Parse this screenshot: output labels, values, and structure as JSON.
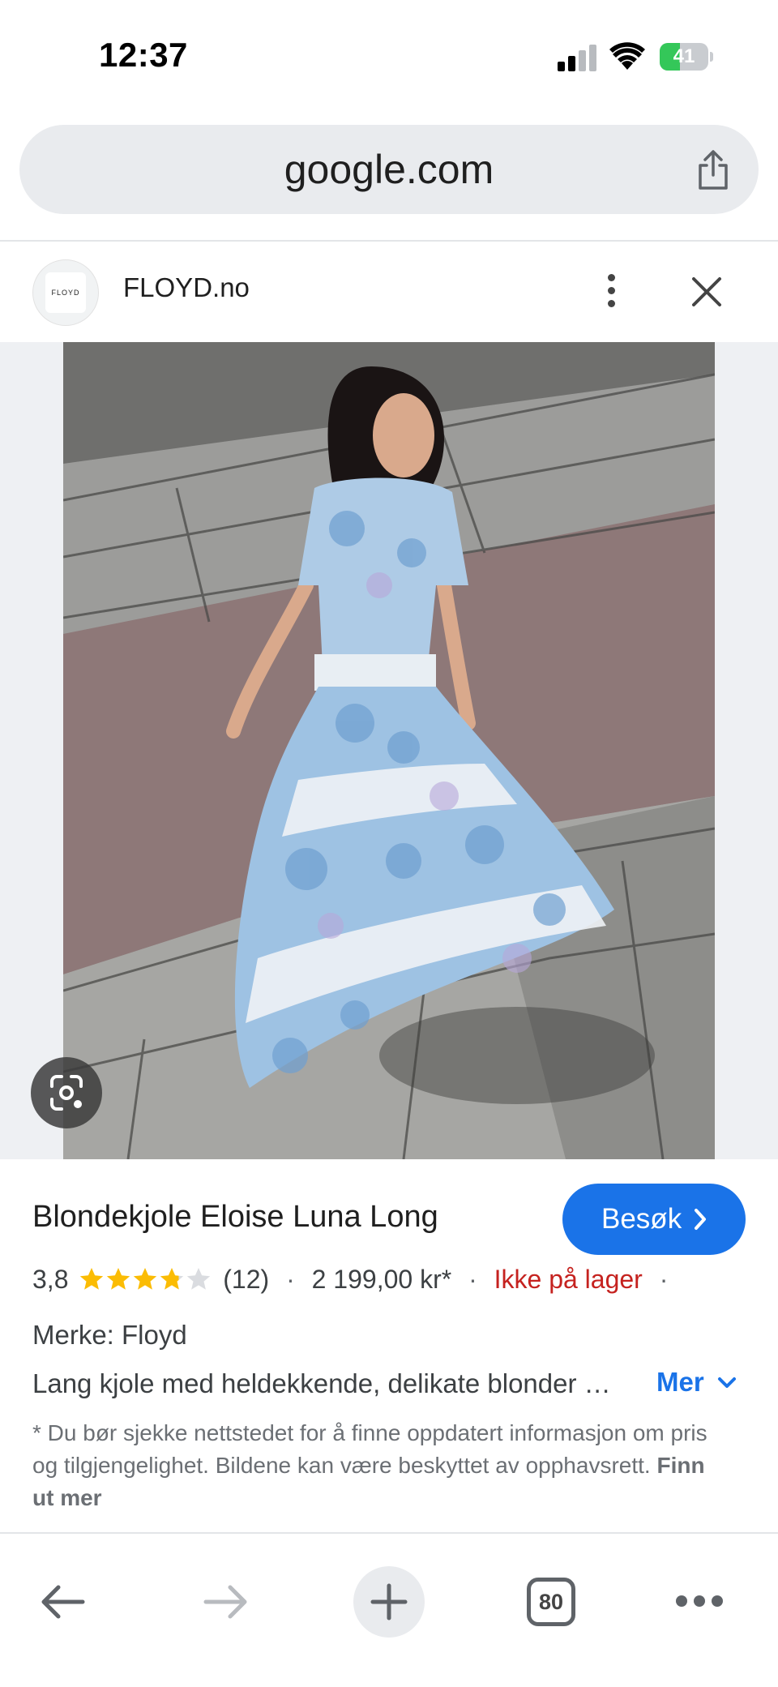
{
  "status_bar": {
    "time": "12:37",
    "battery_level": "41",
    "icons": [
      "signal-icon",
      "wifi-icon",
      "battery-charging-icon"
    ]
  },
  "url_bar": {
    "url": "google.com",
    "share_icon": "share-icon"
  },
  "site": {
    "name": "FLOYD.no",
    "logo_text": "FLOYD",
    "menu_icon": "more-vertical-icon",
    "close_icon": "close-icon"
  },
  "image": {
    "lens_icon": "google-lens-icon"
  },
  "product": {
    "title": "Blondekjole Eloise Luna Long",
    "visit_label": "Besøk",
    "rating": "3,8",
    "rating_value": 3.8,
    "rating_max": 5,
    "review_count": "(12)",
    "price": "2 199,00 kr*",
    "stock": "Ikke på lager",
    "separator": "·",
    "brand": "Merke: Floyd",
    "description": "Lang kjole med heldekkende, delikate blonder …",
    "more_label": "Mer",
    "disclaimer": "* Du bør sjekke nettstedet for å finne oppdatert informasjon om pris og tilgjengelighet. Bildene kan være beskyttet av opphavsrett.",
    "learn_more": "Finn ut mer"
  },
  "toolbar": {
    "tab_count": "80",
    "icons": [
      "back-arrow-icon",
      "forward-arrow-icon",
      "plus-icon",
      "tabs-icon",
      "more-horizontal-icon"
    ]
  },
  "colors": {
    "accent": "#1a73e8",
    "out_of_stock": "#c5221f",
    "star": "#fbbc04",
    "battery": "#34c759"
  }
}
